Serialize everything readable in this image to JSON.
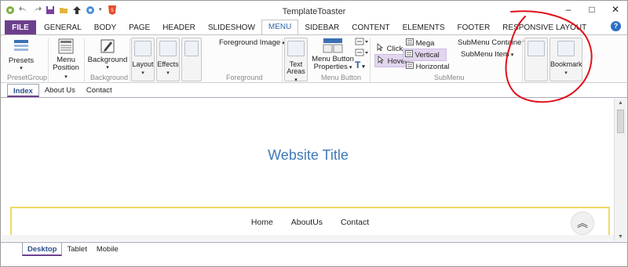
{
  "app": {
    "title": "TemplateToaster"
  },
  "window_controls": {
    "minimize": "–",
    "maximize": "□",
    "close": "✕"
  },
  "quick_access": [
    "app-icon",
    "undo-icon",
    "redo-icon",
    "save-icon",
    "open-folder-icon",
    "upload-icon",
    "settings-icon",
    "html5-icon"
  ],
  "tabs": [
    "FILE",
    "GENERAL",
    "BODY",
    "PAGE",
    "HEADER",
    "SLIDESHOW",
    "MENU",
    "SIDEBAR",
    "CONTENT",
    "ELEMENTS",
    "FOOTER",
    "RESPONSIVE LAYOUT"
  ],
  "active_tab": "MENU",
  "help": "?",
  "ribbon": {
    "presets": {
      "label": "Presets",
      "group": "PresetGroup"
    },
    "menu_position": {
      "label1": "Menu",
      "label2": "Position"
    },
    "background": {
      "label": "Background",
      "group": "Background"
    },
    "layout": {
      "label": "Layout"
    },
    "effects": {
      "label": "Effects"
    },
    "foreground": {
      "image_label": "Foreground Image",
      "group": "Foreground"
    },
    "text_areas": {
      "label1": "Text",
      "label2": "Areas"
    },
    "menu_button": {
      "label1": "Menu Button",
      "label2": "Properties",
      "group": "Menu Button"
    },
    "submenu": {
      "click": "Click",
      "hover": "Hover",
      "mega": "Mega",
      "vertical": "Vertical",
      "horizontal": "Horizontal",
      "container": "SubMenu Container",
      "item": "SubMenu Item",
      "group": "SubMenu"
    },
    "bookmark": {
      "label": "Bookmark"
    }
  },
  "page_tabs": [
    "Index",
    "About Us",
    "Contact"
  ],
  "active_page": "Index",
  "canvas": {
    "site_title": "Website Title",
    "menu_items": [
      "Home",
      "AboutUs",
      "Contact"
    ]
  },
  "device_tabs": [
    "Desktop",
    "Tablet",
    "Mobile"
  ],
  "active_device": "Desktop",
  "colors": {
    "file_tab": "#6c3f8d",
    "accent": "#3367a9",
    "site_title": "#3d7ab8",
    "menu_border": "#efd861",
    "annotation": "#e0101a"
  }
}
